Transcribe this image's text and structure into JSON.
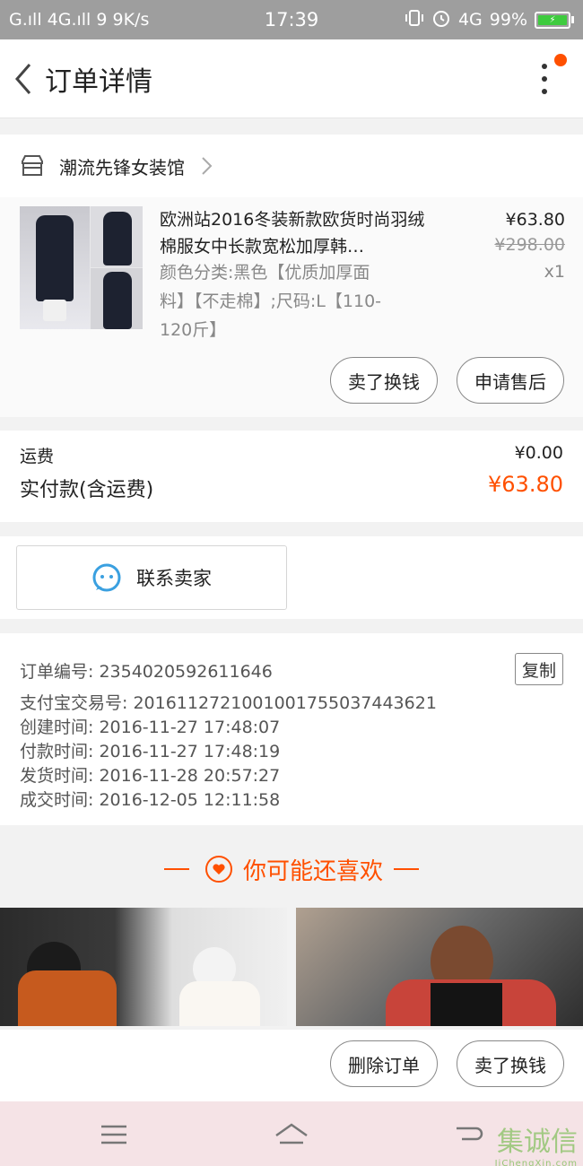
{
  "status_bar": {
    "left": "G.ıll 4G.ıll 9 9K/s",
    "time": "17:39",
    "network": "4G",
    "battery": "99%"
  },
  "header": {
    "title": "订单详情"
  },
  "shop": {
    "name": "潮流先锋女装馆"
  },
  "product": {
    "title": "欧洲站2016冬装新款欧货时尚羽绒棉服女中长款宽松加厚韩…",
    "spec": "颜色分类:黑色【优质加厚面料】【不走棉】;尺码:L【110-120斤】",
    "price": "¥63.80",
    "original_price": "¥298.00",
    "quantity": "x1",
    "buttons": [
      "卖了换钱",
      "申请售后"
    ]
  },
  "fee": {
    "shipping_label": "运费",
    "shipping_value": "¥0.00",
    "paid_label": "实付款(含运费)",
    "paid_value": "¥63.80"
  },
  "contact": {
    "label": "联系卖家"
  },
  "order_info": {
    "copy_label": "复制",
    "rows": [
      "订单编号: 2354020592611646",
      "支付宝交易号: 2016112721001001755037443621",
      "创建时间: 2016-11-27  17:48:07",
      "付款时间: 2016-11-27  17:48:19",
      "发货时间: 2016-11-28  20:57:27",
      "成交时间: 2016-12-05  12:11:58"
    ]
  },
  "recommend": {
    "title": "你可能还喜欢"
  },
  "bottom_actions": [
    "删除订单",
    "卖了换钱"
  ],
  "watermark": {
    "main": "集诚信",
    "sub": "JiChengXin.com"
  },
  "colors": {
    "accent": "#ff5000",
    "status_bar": "#9e9e9e",
    "nav_bar": "#f5e3e6"
  }
}
